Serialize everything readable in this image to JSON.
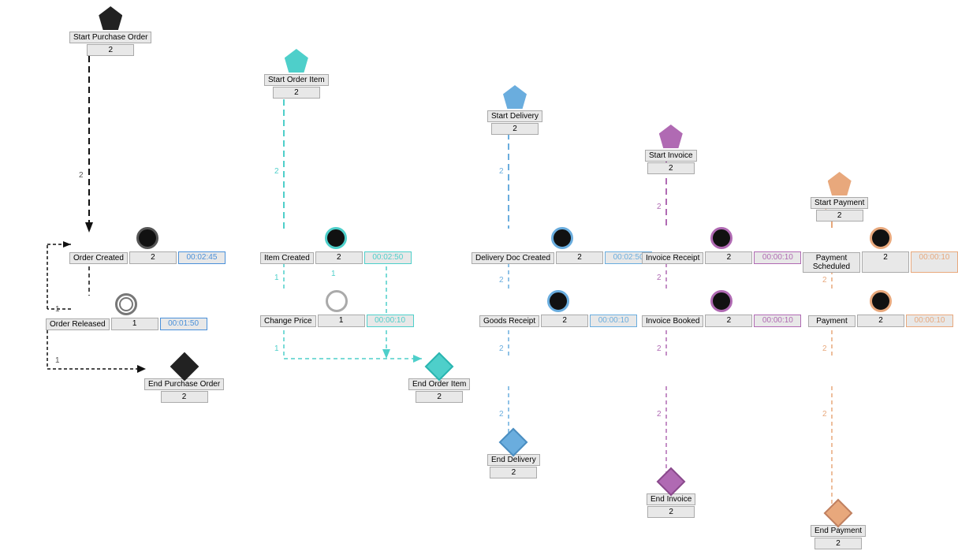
{
  "nodes": {
    "startPurchaseOrder": {
      "label": "Start Purchase Order",
      "count": "2"
    },
    "orderCreated": {
      "label": "Order Created",
      "count": "2",
      "time": "00:02:45"
    },
    "orderReleased": {
      "label": "Order Released",
      "count": "1",
      "time": "00:01:50"
    },
    "endPurchaseOrder": {
      "label": "End Purchase Order",
      "count": "2"
    },
    "startOrderItem": {
      "label": "Start Order Item",
      "count": "2"
    },
    "itemCreated": {
      "label": "Item Created",
      "count": "2",
      "time": "00:02:50"
    },
    "changePrice": {
      "label": "Change Price",
      "count": "1",
      "time": "00:00:10"
    },
    "endOrderItem": {
      "label": "End Order Item",
      "count": "2"
    },
    "startDelivery": {
      "label": "Start Delivery",
      "count": "2"
    },
    "deliveryDocCreated": {
      "label": "Delivery Doc Created",
      "count": "2",
      "time": "00:02:50"
    },
    "goodsReceipt": {
      "label": "Goods Receipt",
      "count": "2",
      "time": "00:00:10"
    },
    "endDelivery": {
      "label": "End Delivery",
      "count": "2"
    },
    "startInvoice": {
      "label": "Start Invoice",
      "count": "2"
    },
    "invoiceReceipt": {
      "label": "Invoice Receipt",
      "count": "2",
      "time": "00:00:10"
    },
    "invoiceBooked": {
      "label": "Invoice Booked",
      "count": "2",
      "time": "00:00:10"
    },
    "endInvoice": {
      "label": "End Invoice",
      "count": "2"
    },
    "startPayment": {
      "label": "Start Payment",
      "count": "2"
    },
    "paymentScheduled": {
      "label": "Payment Scheduled",
      "count": "2",
      "time": "00:00:10"
    },
    "payment": {
      "label": "Payment",
      "count": "2",
      "time": "00:00:10"
    },
    "endPayment": {
      "label": "End Payment",
      "count": "2"
    }
  },
  "colors": {
    "black": "#111111",
    "teal": "#4ecfca",
    "blue": "#6aadde",
    "purple": "#b06ab3",
    "orange": "#e8a87c"
  }
}
